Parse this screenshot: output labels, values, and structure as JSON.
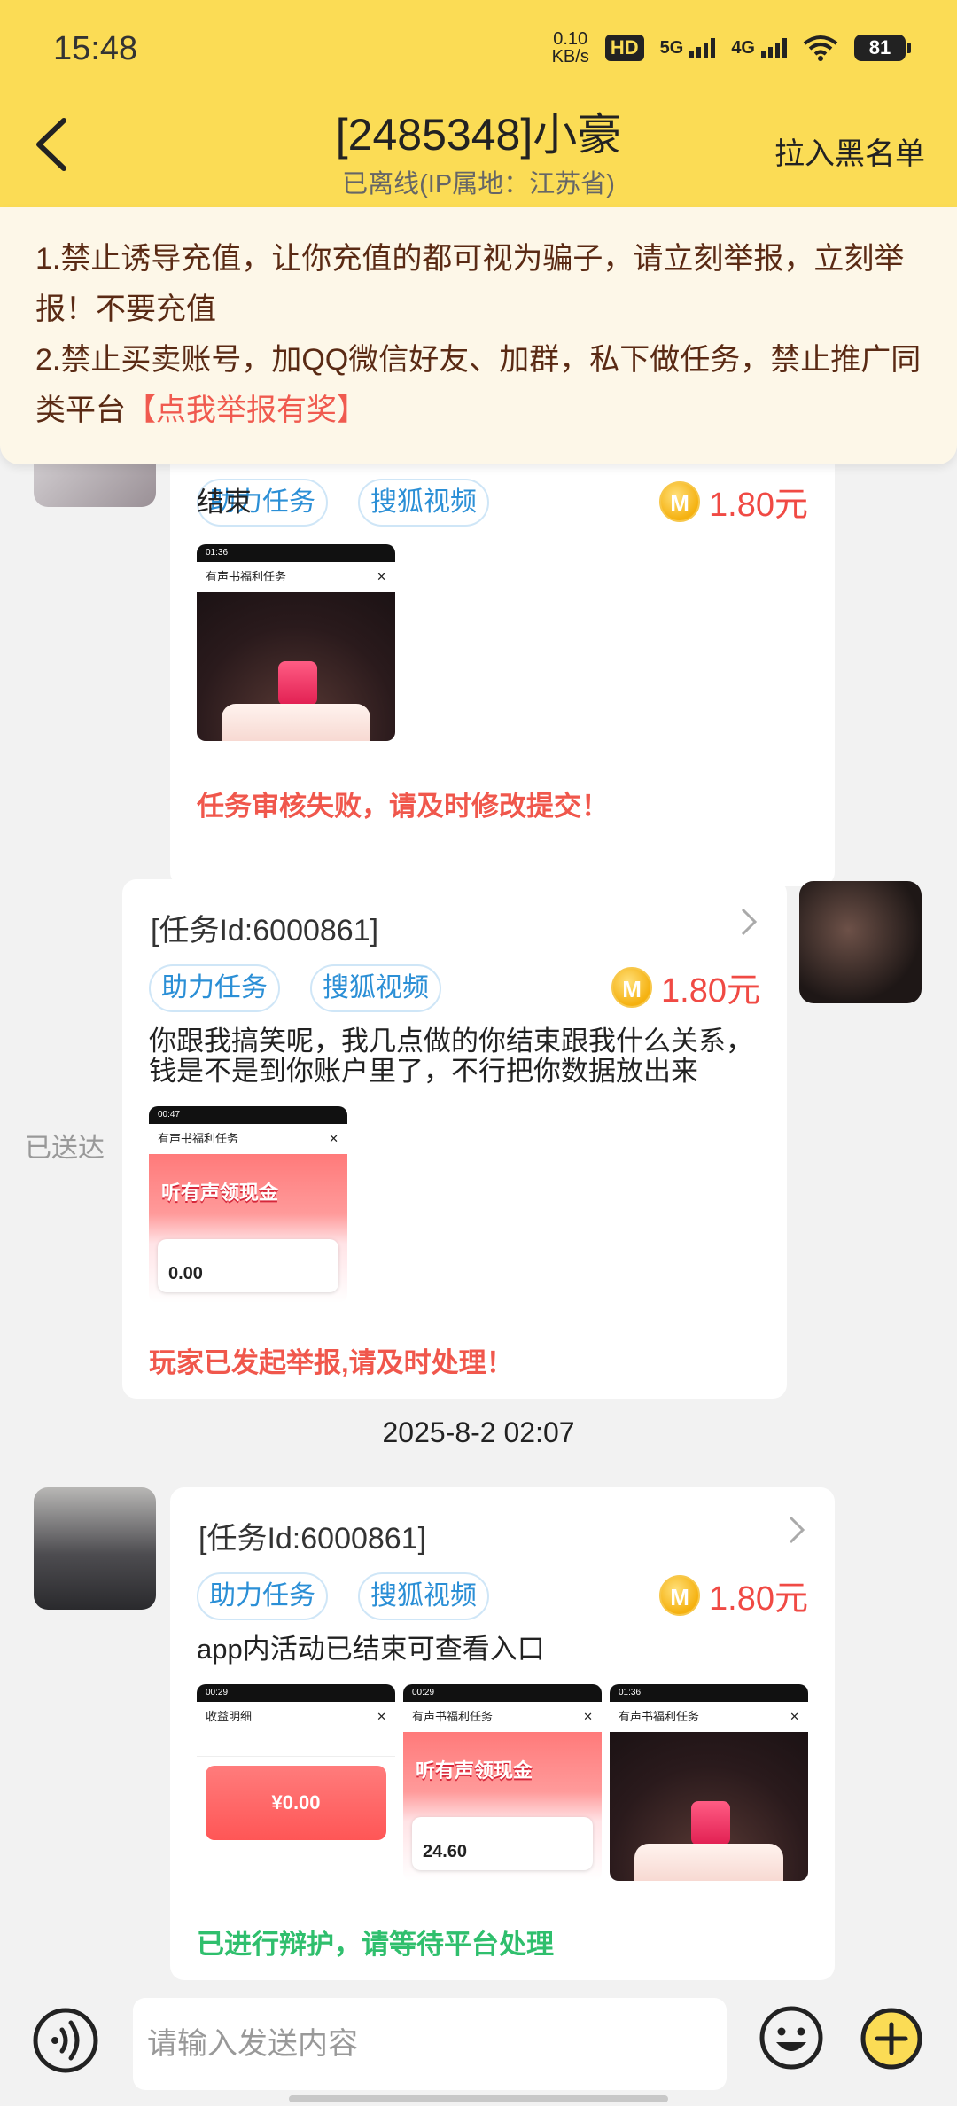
{
  "status_bar": {
    "time": "15:48",
    "net_speed_value": "0.10",
    "net_speed_unit": "KB/s",
    "hd_label": "HD",
    "signal1_label": "5G",
    "signal2_label": "4G",
    "battery": "81"
  },
  "header": {
    "title": "[2485348]小豪",
    "subtitle": "已离线(IP属地：江苏省)",
    "blacklist_label": "拉入黑名单"
  },
  "notice": {
    "line1": "1.禁止诱导充值，让你充值的都可视为骗子，请立刻举报，立刻举报！不要充值",
    "line2": "2.禁止买卖账号，加QQ微信好友、加群，私下做任务，禁止推广同类平台",
    "report_link": "【点我举报有奖】"
  },
  "messages": [
    {
      "side": "left",
      "tags": [
        "助力任务",
        "搜狐视频"
      ],
      "reward": "1.80元",
      "text": "结束",
      "status": "任务审核失败，请及时修改提交！",
      "shots": [
        {
          "title": "有声书福利任务",
          "time": "01:36"
        }
      ]
    },
    {
      "side": "right",
      "task_id": "[任务Id:6000861]",
      "tags": [
        "助力任务",
        "搜狐视频"
      ],
      "reward": "1.80元",
      "text": "你跟我搞笑呢，我几点做的你结束跟我什么关系，钱是不是到你账户里了，不行把你数据放出来",
      "status": "玩家已发起举报,请及时处理！",
      "delivery": "已送达",
      "shots": [
        {
          "title": "有声书福利任务",
          "time": "00:47",
          "headline": "听有声领现金",
          "amount": "0.00"
        }
      ]
    },
    {
      "side": "left",
      "task_id": "[任务Id:6000861]",
      "tags": [
        "助力任务",
        "搜狐视频"
      ],
      "reward": "1.80元",
      "text": "app内活动已结束可查看入口",
      "status": "已进行辩护，请等待平台处理",
      "shots": [
        {
          "title": "收益明细",
          "time": "00:29",
          "amount": "¥0.00"
        },
        {
          "title": "有声书福利任务",
          "time": "00:29",
          "headline": "听有声领现金",
          "amount": "24.60"
        },
        {
          "title": "有声书福利任务",
          "time": "01:36"
        }
      ]
    }
  ],
  "timestamp": "2025-8-2 02:07",
  "coin_glyph": "M",
  "input": {
    "placeholder": "请输入发送内容"
  },
  "colors": {
    "accent": "#fbdc55",
    "warning_red": "#f0574c",
    "success_green": "#2fbf6d",
    "tag_blue": "#2b8fd6"
  }
}
